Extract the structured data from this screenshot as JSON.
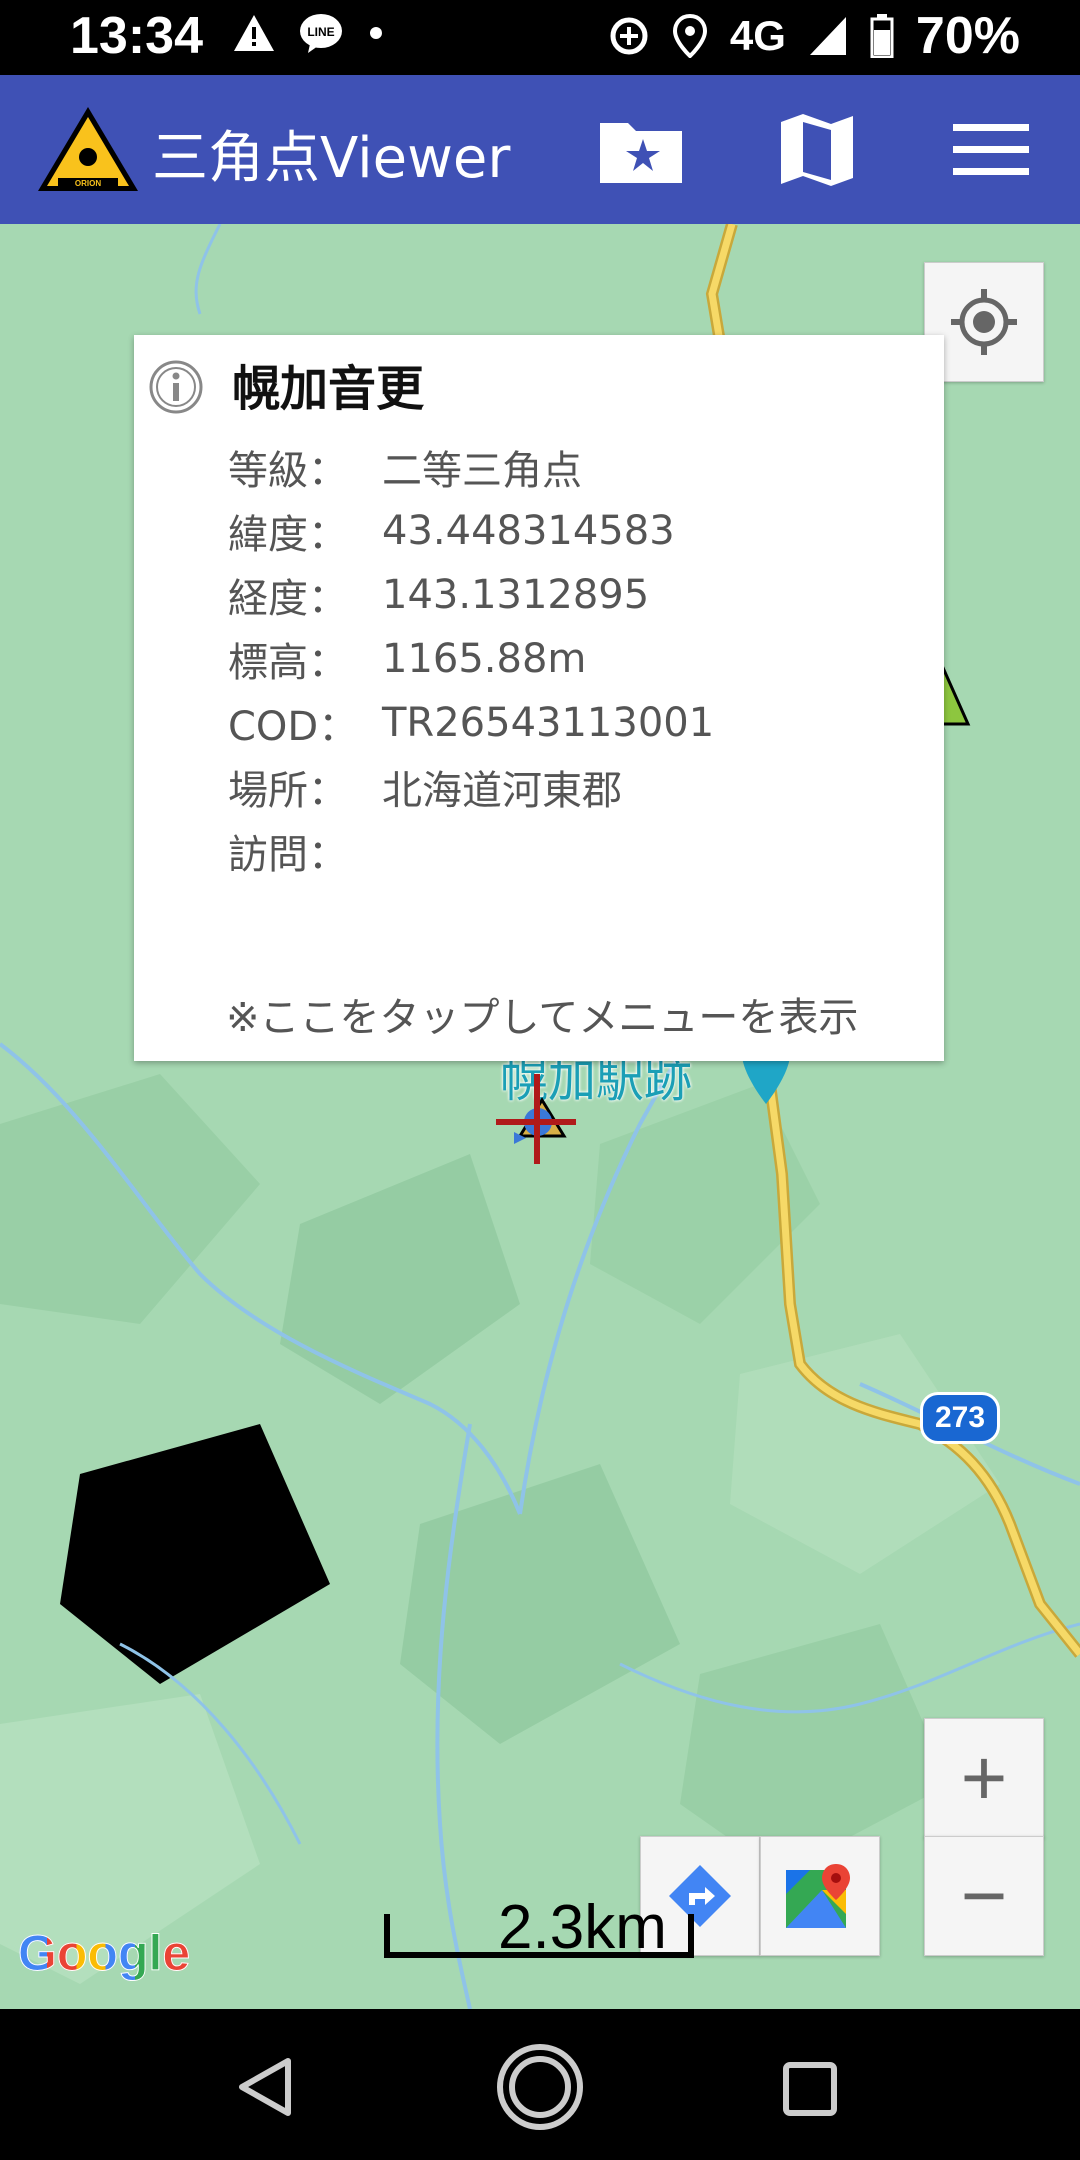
{
  "status": {
    "time": "13:34",
    "network": "4G",
    "battery": "70%"
  },
  "app_bar": {
    "title": "三角点Viewer",
    "logo_text": "ORION"
  },
  "info_window": {
    "title": "幌加音更",
    "rows": [
      {
        "key": "等級：",
        "value": "二等三角点"
      },
      {
        "key": "緯度：",
        "value": "43.448314583"
      },
      {
        "key": "経度：",
        "value": "143.1312895"
      },
      {
        "key": "標高：",
        "value": "1165.88m"
      },
      {
        "key": "COD：",
        "value": "TR26543113001"
      },
      {
        "key": "場所：",
        "value": "北海道河東郡"
      },
      {
        "key": "訪問：",
        "value": ""
      }
    ],
    "hint": "※ここをタップしてメニューを表示"
  },
  "map": {
    "place_label": "幌加駅跡",
    "route_badge": "273",
    "scale_label": "2.3km",
    "attribution": "Google",
    "zoom_in": "+",
    "zoom_out": "−"
  },
  "colors": {
    "app_bar": "#3F51B5",
    "map_bg": "#a6d8b2",
    "road": "#f4c542",
    "route_badge": "#1967d2"
  }
}
